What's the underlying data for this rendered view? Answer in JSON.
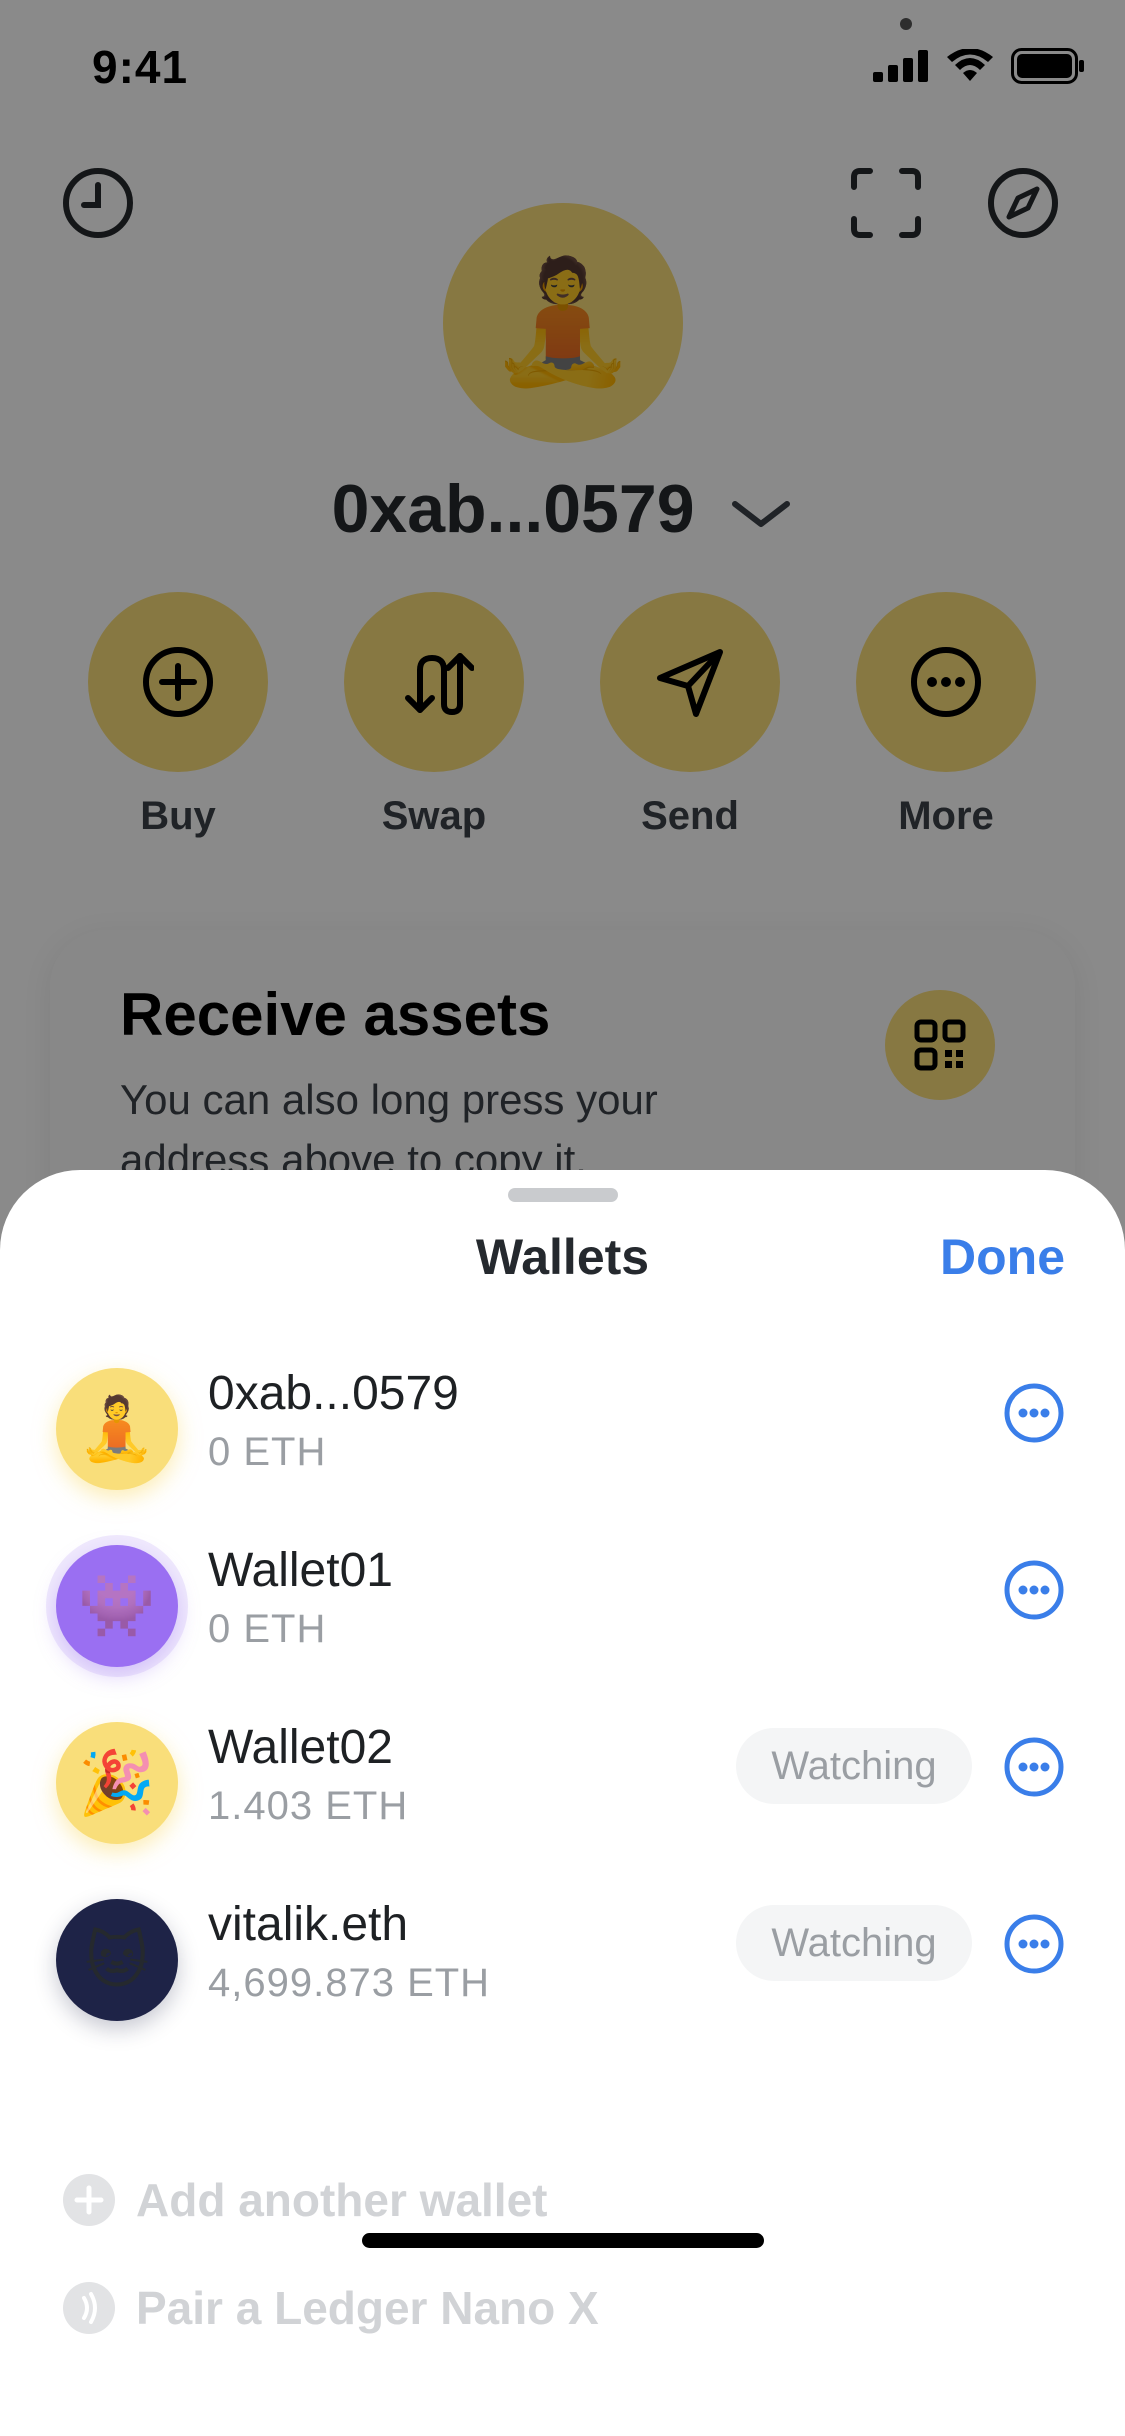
{
  "status_bar": {
    "time": "9:41"
  },
  "profile": {
    "account_name": "0xab...0579",
    "avatar_emoji": "🧘"
  },
  "actions": [
    {
      "label": "Buy",
      "icon": "plus-circle-icon"
    },
    {
      "label": "Swap",
      "icon": "swap-icon"
    },
    {
      "label": "Send",
      "icon": "send-icon"
    },
    {
      "label": "More",
      "icon": "more-icon"
    }
  ],
  "receive_card": {
    "title": "Receive assets",
    "subtitle": "You can also long press your address above to copy it."
  },
  "sheet": {
    "title": "Wallets",
    "done_label": "Done",
    "wallets": [
      {
        "name": "0xab...0579",
        "balance": "0 ETH",
        "avatar_emoji": "🧘",
        "avatar_color": "#f9de7a",
        "watching": ""
      },
      {
        "name": "Wallet01",
        "balance": "0 ETH",
        "avatar_emoji": "👾",
        "avatar_color": "#9a6ff2",
        "watching": ""
      },
      {
        "name": "Wallet02",
        "balance": "1.403 ETH",
        "avatar_emoji": "🎉",
        "avatar_color": "#f9de7a",
        "watching": "Watching"
      },
      {
        "name": "vitalik.eth",
        "balance": "4,699.873 ETH",
        "avatar_emoji": "🐱",
        "avatar_color": "#1e2347",
        "watching": "Watching"
      }
    ],
    "add_wallet_label": "Add another wallet",
    "pair_ledger_label": "Pair a Ledger Nano X"
  },
  "colors": {
    "accent": "#3a7ee9",
    "avatar_yellow": "#f9de7a",
    "muted": "#9a9ea3"
  }
}
